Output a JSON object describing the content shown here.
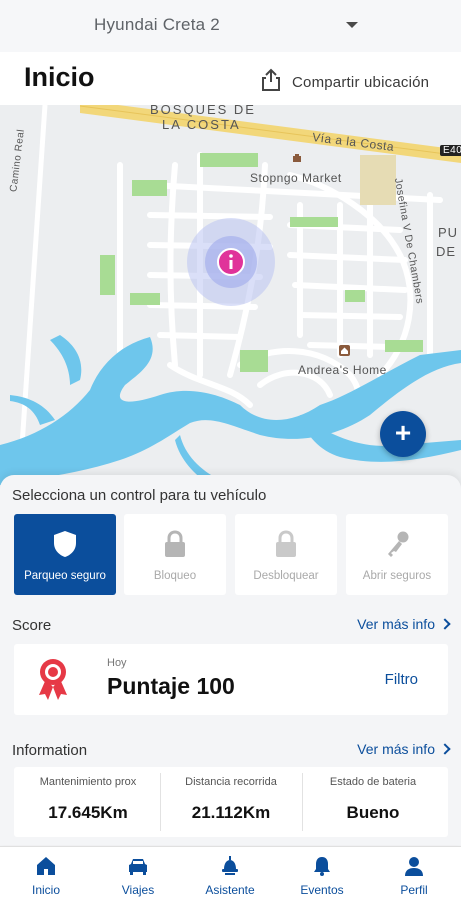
{
  "topbar": {
    "vehicle": "Hyundai Creta 2"
  },
  "header": {
    "title": "Inicio",
    "share_label": "Compartir ubicación"
  },
  "map": {
    "labels": {
      "bosques1": "BOSQUES DE",
      "bosques2": "LA COSTA",
      "via": "Vía a la Costa",
      "road_badge": "E40",
      "camino": "Camino Real",
      "market": "Stopngo Market",
      "jose": "Josefina V De Chambers",
      "pu": "PU",
      "de": "DE",
      "home": "Andrea's Home"
    },
    "fab_label": "+"
  },
  "controls": {
    "title": "Selecciona un control para tu vehículo",
    "items": [
      {
        "label": "Parqueo seguro",
        "icon": "shield-icon",
        "active": true
      },
      {
        "label": "Bloqueo",
        "icon": "lock-icon",
        "active": false
      },
      {
        "label": "Desbloquear",
        "icon": "unlock-icon",
        "active": false
      },
      {
        "label": "Abrir seguros",
        "icon": "key-icon",
        "active": false
      }
    ]
  },
  "score": {
    "title": "Score",
    "more": "Ver más info",
    "today": "Hoy",
    "value": "Puntaje 100",
    "filter": "Filtro"
  },
  "information": {
    "title": "Information",
    "more": "Ver más info",
    "items": [
      {
        "label": "Mantenimiento prox",
        "value": "17.645Km"
      },
      {
        "label": "Distancia recorrida",
        "value": "21.112Km"
      },
      {
        "label": "Estado de bateria",
        "value": "Bueno"
      }
    ]
  },
  "tabs": [
    {
      "label": "Inicio",
      "icon": "home-icon"
    },
    {
      "label": "Viajes",
      "icon": "car-icon"
    },
    {
      "label": "Asistente",
      "icon": "assistant-icon"
    },
    {
      "label": "Eventos",
      "icon": "bell-icon"
    },
    {
      "label": "Perfil",
      "icon": "user-icon"
    }
  ],
  "colors": {
    "primary": "#0b4e9c",
    "water": "#6ec6ec",
    "park": "#a8dc94",
    "road_yellow": "#f2d77a",
    "marker": "#e0339a"
  }
}
